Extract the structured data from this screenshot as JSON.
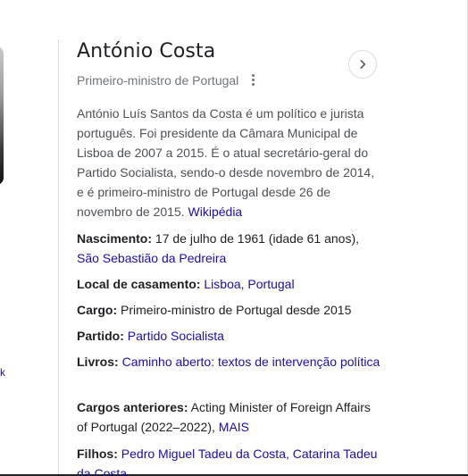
{
  "left_fragment": {
    "link_text": "k"
  },
  "header": {
    "title": "António Costa",
    "subtitle": "Primeiro-ministro de Portugal"
  },
  "description": {
    "text": "António Luís Santos da Costa é um político e jurista português. Foi presidente da Câmara Municipal de Lisboa de 2007 a 2015. É o atual secretário-geral do Partido Socialista, sendo-o desde novembro de 2014, e é primeiro-ministro de Portugal desde 26 de novembro de 2015.",
    "source_link": "Wikipédia"
  },
  "facts": {
    "nascimento": {
      "label": "Nascimento:",
      "value": "17 de julho de 1961 (idade 61 anos),",
      "link": "São Sebastião da Pedreira"
    },
    "casamento": {
      "label": "Local de casamento:",
      "link": "Lisboa, Portugal"
    },
    "cargo": {
      "label": "Cargo:",
      "value": "Primeiro-ministro de Portugal desde 2015"
    },
    "partido": {
      "label": "Partido:",
      "link": "Partido Socialista"
    },
    "livros": {
      "label": "Livros:",
      "link": "Caminho aberto: textos de intervenção política"
    },
    "cargos_anteriores": {
      "label": "Cargos anteriores:",
      "value": "Acting Minister of Foreign Affairs of Portugal (2022–2022),",
      "link": "MAIS"
    },
    "filhos": {
      "label": "Filhos:",
      "link": "Pedro Miguel Tadeu da Costa, Catarina Tadeu da Costa"
    }
  },
  "colors": {
    "link": "#1a0dab",
    "text": "#202124",
    "muted": "#70757a",
    "description": "#4d5156",
    "border": "#dadce0"
  },
  "icons": {
    "more": "more-vert-icon",
    "next": "chevron-right-icon"
  }
}
